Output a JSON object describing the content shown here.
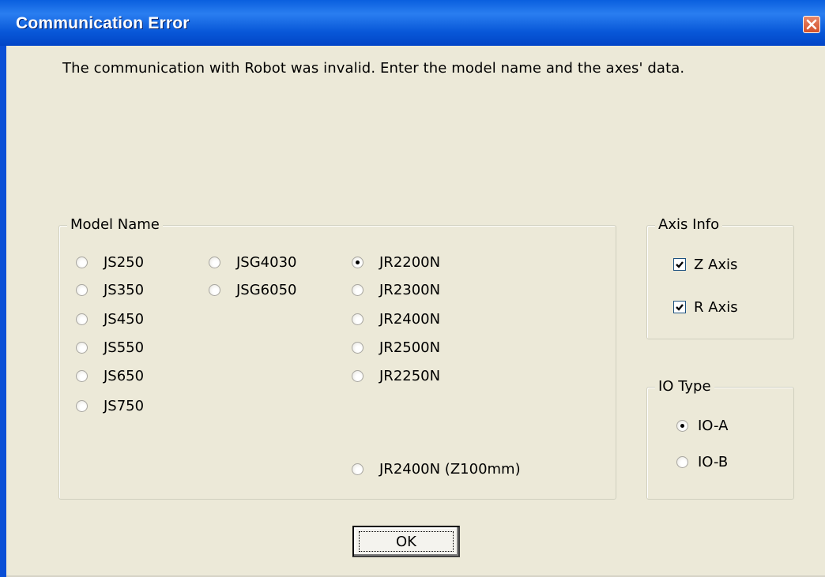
{
  "window": {
    "title": "Communication Error"
  },
  "message": "The communication with Robot was invalid. Enter the model name and the axes' data.",
  "model_group": {
    "legend": "Model Name",
    "options": [
      {
        "label": "JS250",
        "selected": false
      },
      {
        "label": "JS350",
        "selected": false
      },
      {
        "label": "JS450",
        "selected": false
      },
      {
        "label": "JS550",
        "selected": false
      },
      {
        "label": "JS650",
        "selected": false
      },
      {
        "label": "JS750",
        "selected": false
      },
      {
        "label": "JSG4030",
        "selected": false
      },
      {
        "label": "JSG6050",
        "selected": false
      },
      {
        "label": "JR2200N",
        "selected": true
      },
      {
        "label": "JR2300N",
        "selected": false
      },
      {
        "label": "JR2400N",
        "selected": false
      },
      {
        "label": "JR2500N",
        "selected": false
      },
      {
        "label": "JR2250N",
        "selected": false
      },
      {
        "label": "JR2400N (Z100mm)",
        "selected": false
      }
    ]
  },
  "axis_group": {
    "legend": "Axis Info",
    "options": [
      {
        "label": "Z Axis",
        "checked": true
      },
      {
        "label": "R Axis",
        "checked": true
      }
    ]
  },
  "io_group": {
    "legend": "IO Type",
    "options": [
      {
        "label": "IO-A",
        "selected": true
      },
      {
        "label": "IO-B",
        "selected": false
      }
    ]
  },
  "ok_button": {
    "label": "OK"
  }
}
